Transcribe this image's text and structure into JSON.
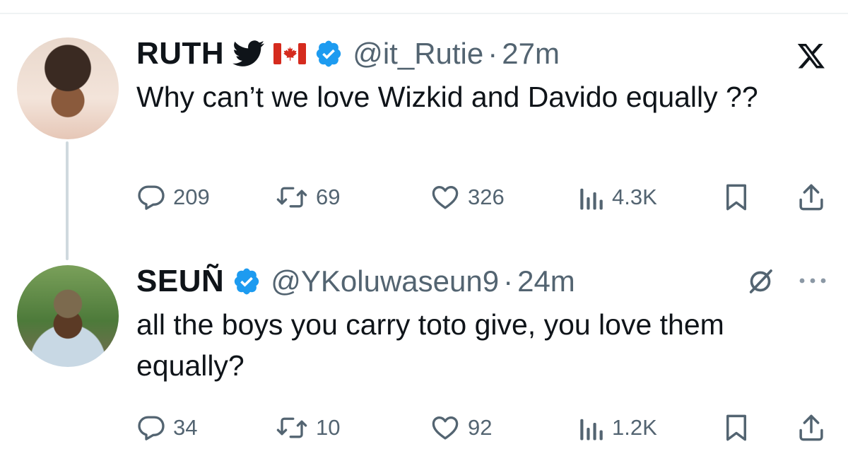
{
  "tweets": [
    {
      "display_name": "RUTH",
      "name_emojis": [
        "bird-icon",
        "canada-flag-icon"
      ],
      "verified": true,
      "handle": "@it_Rutie",
      "separator": "·",
      "time": "27m",
      "text": "Why can’t we love Wizkid and Davido equally ??",
      "stats": {
        "replies": "209",
        "reposts": "69",
        "likes": "326",
        "views": "4.3K"
      }
    },
    {
      "display_name": "SEUÑ",
      "verified": true,
      "handle": "@YKoluwaseun9",
      "separator": "·",
      "time": "24m",
      "text": "all the boys you carry toto give, you love them equally?",
      "stats": {
        "replies": "34",
        "reposts": "10",
        "likes": "92",
        "views": "1.2K"
      }
    }
  ],
  "icons": {
    "top_right": "x-logo-icon",
    "reply_corner": [
      "grok-icon",
      "more-icon"
    ],
    "actions": [
      "reply-icon",
      "repost-icon",
      "like-icon",
      "views-icon",
      "bookmark-icon",
      "share-icon"
    ]
  },
  "colors": {
    "text": "#0f1419",
    "secondary": "#536471",
    "verified_blue": "#1d9bf0",
    "thread_line": "#cfd9de",
    "flag_red": "#d52b1e"
  }
}
